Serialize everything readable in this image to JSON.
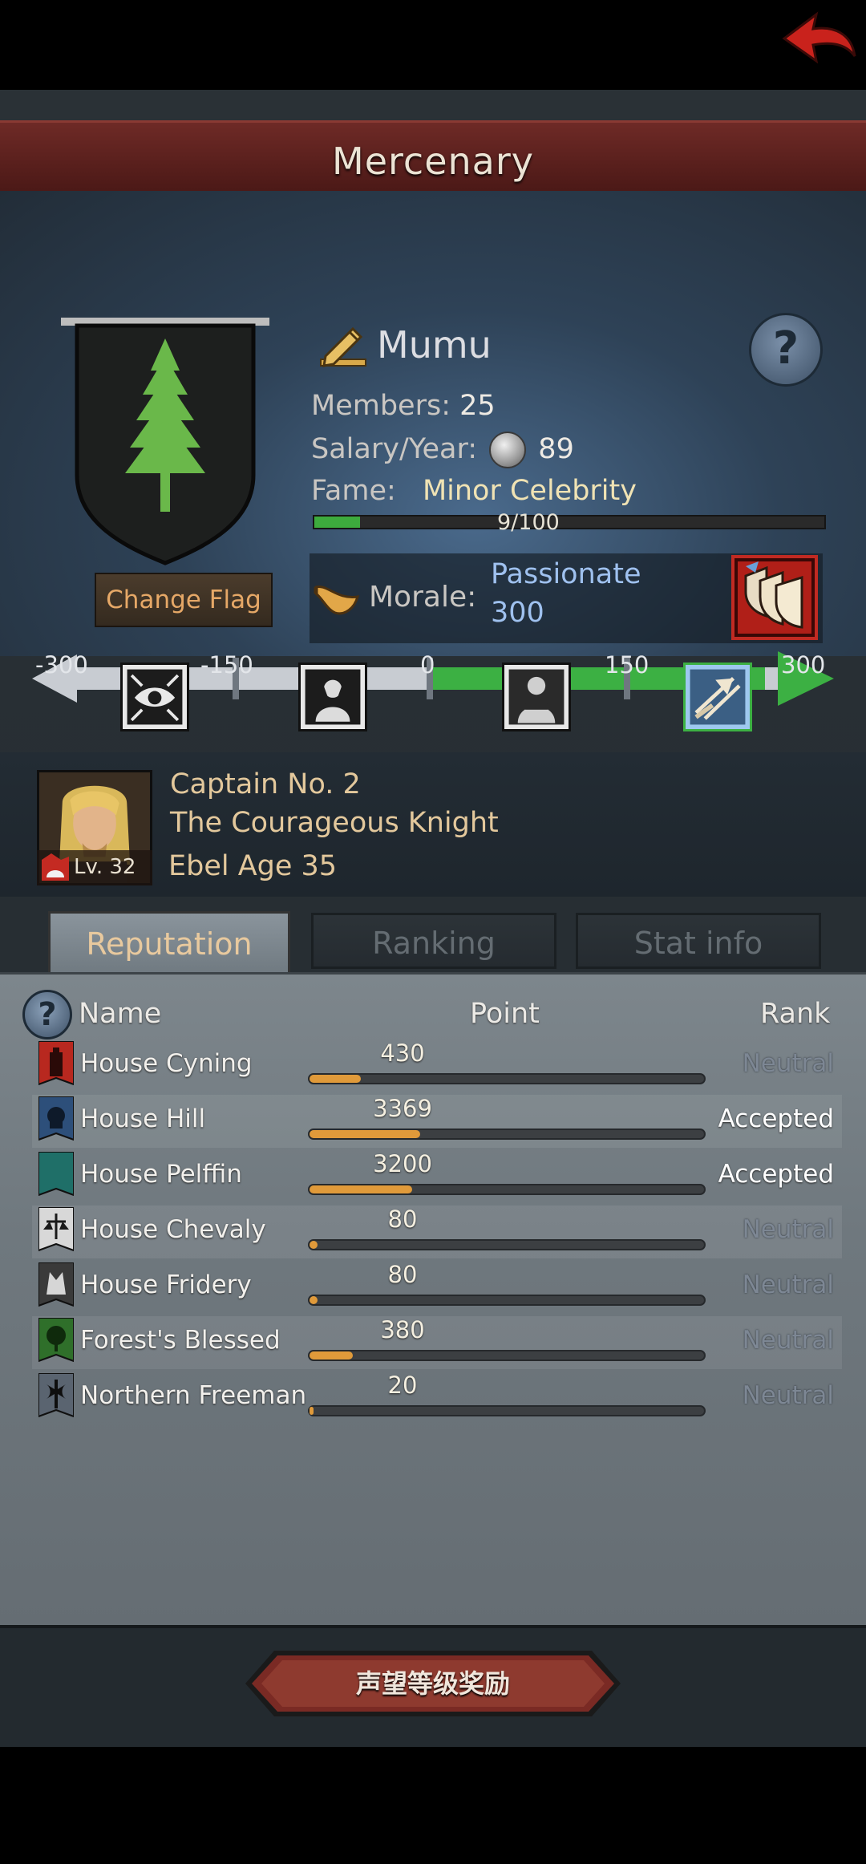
{
  "header": {
    "title": "Mercenary"
  },
  "profile": {
    "name": "Mumu",
    "members_label": "Members:",
    "members_value": "25",
    "salary_label": "Salary/Year:",
    "salary_value": "89",
    "fame_label": "Fame:",
    "fame_value": "Minor Celebrity",
    "fame_progress_text": "9/100",
    "fame_progress": 0.09,
    "change_flag_label": "Change Flag",
    "morale_label": "Morale:",
    "morale_state": "Passionate",
    "morale_value": "300"
  },
  "morale_scale": {
    "ticks": [
      "-300",
      "-150",
      "0",
      "150",
      "300"
    ],
    "current_value": 300
  },
  "captain": {
    "number": "Captain No. 2",
    "title": "The Courageous Knight",
    "name_age": "Ebel  Age  35",
    "level": "Lv. 32"
  },
  "tabs": [
    {
      "label": "Reputation",
      "active": true
    },
    {
      "label": "Ranking",
      "active": false
    },
    {
      "label": "Stat info",
      "active": false
    }
  ],
  "table": {
    "headers": {
      "name": "Name",
      "point": "Point",
      "rank": "Rank"
    },
    "rows": [
      {
        "name": "House Cyning",
        "point": "430",
        "fill": 0.13,
        "rank": "Neutral",
        "accepted": false,
        "icon": "red-tower-banner-icon"
      },
      {
        "name": "House Hill",
        "point": "3369",
        "fill": 0.28,
        "rank": "Accepted",
        "accepted": true,
        "icon": "blue-helmet-banner-icon"
      },
      {
        "name": "House Pelffin",
        "point": "3200",
        "fill": 0.26,
        "rank": "Accepted",
        "accepted": true,
        "icon": "teal-moon-banner-icon"
      },
      {
        "name": "House Chevaly",
        "point": "80",
        "fill": 0.02,
        "rank": "Neutral",
        "accepted": false,
        "icon": "scales-banner-icon"
      },
      {
        "name": "House Fridery",
        "point": "80",
        "fill": 0.02,
        "rank": "Neutral",
        "accepted": false,
        "icon": "wolf-banner-icon"
      },
      {
        "name": "Forest's Blessed",
        "point": "380",
        "fill": 0.11,
        "rank": "Neutral",
        "accepted": false,
        "icon": "green-tree-banner-icon"
      },
      {
        "name": "Northern Freeman",
        "point": "20",
        "fill": 0.0,
        "rank": "Neutral",
        "accepted": false,
        "icon": "axe-banner-icon"
      }
    ]
  },
  "footer": {
    "reward_button_label": "声望等级奖励"
  },
  "colors": {
    "header_red": "#6e2a26",
    "fame_green": "#3dab3d",
    "morale_blue": "#9fc1ef",
    "reputation_orange": "#e09a3a",
    "gold_text": "#e3c89c"
  }
}
